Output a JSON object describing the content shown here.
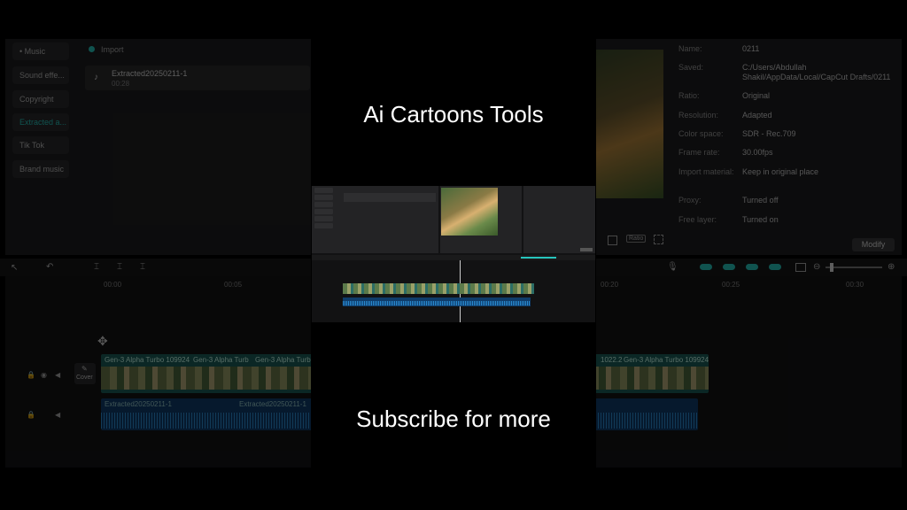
{
  "overlay": {
    "title": "Ai Cartoons Tools",
    "subtitle": "Subscribe for more"
  },
  "sidebar": {
    "items": [
      {
        "label": "• Music"
      },
      {
        "label": "Sound effe..."
      },
      {
        "label": "Copyright"
      },
      {
        "label": "Extracted a..."
      },
      {
        "label": "Tik Tok"
      },
      {
        "label": "Brand music"
      }
    ]
  },
  "media": {
    "import_label": "Import",
    "clip_name": "Extracted20250211-1",
    "clip_duration": "00:28"
  },
  "properties": {
    "rows": [
      {
        "label": "Name:",
        "value": "0211"
      },
      {
        "label": "Saved:",
        "value": "C:/Users/Abdullah Shakil/AppData/Local/CapCut Drafts/0211"
      },
      {
        "label": "Ratio:",
        "value": "Original"
      },
      {
        "label": "Resolution:",
        "value": "Adapted"
      },
      {
        "label": "Color space:",
        "value": "SDR - Rec.709"
      },
      {
        "label": "Frame rate:",
        "value": "30.00fps"
      },
      {
        "label": "Import material:",
        "value": "Keep in original place"
      },
      {
        "label": "Proxy:",
        "value": "Turned off"
      },
      {
        "label": "Free layer:",
        "value": "Turned on"
      }
    ],
    "modify_label": "Modify"
  },
  "timeline": {
    "ticks": [
      "00:00",
      "00:05",
      "00:20",
      "00:25",
      "00:30"
    ],
    "video_clip_label": "Gen-3 Alpha Turbo 109924",
    "video_clip_label_2": "Gen-3 Alpha Turb",
    "video_clip_label_3": "Gen-3 Alpha Turbo",
    "video_clip_right_1": "1022.2",
    "video_clip_right_2": "Gen-3 Alpha Turbo 109924",
    "audio_clip_label": "Extracted20250211-1",
    "cover_label": "Cover"
  },
  "preview": {
    "ratio_label": "Ratio"
  }
}
